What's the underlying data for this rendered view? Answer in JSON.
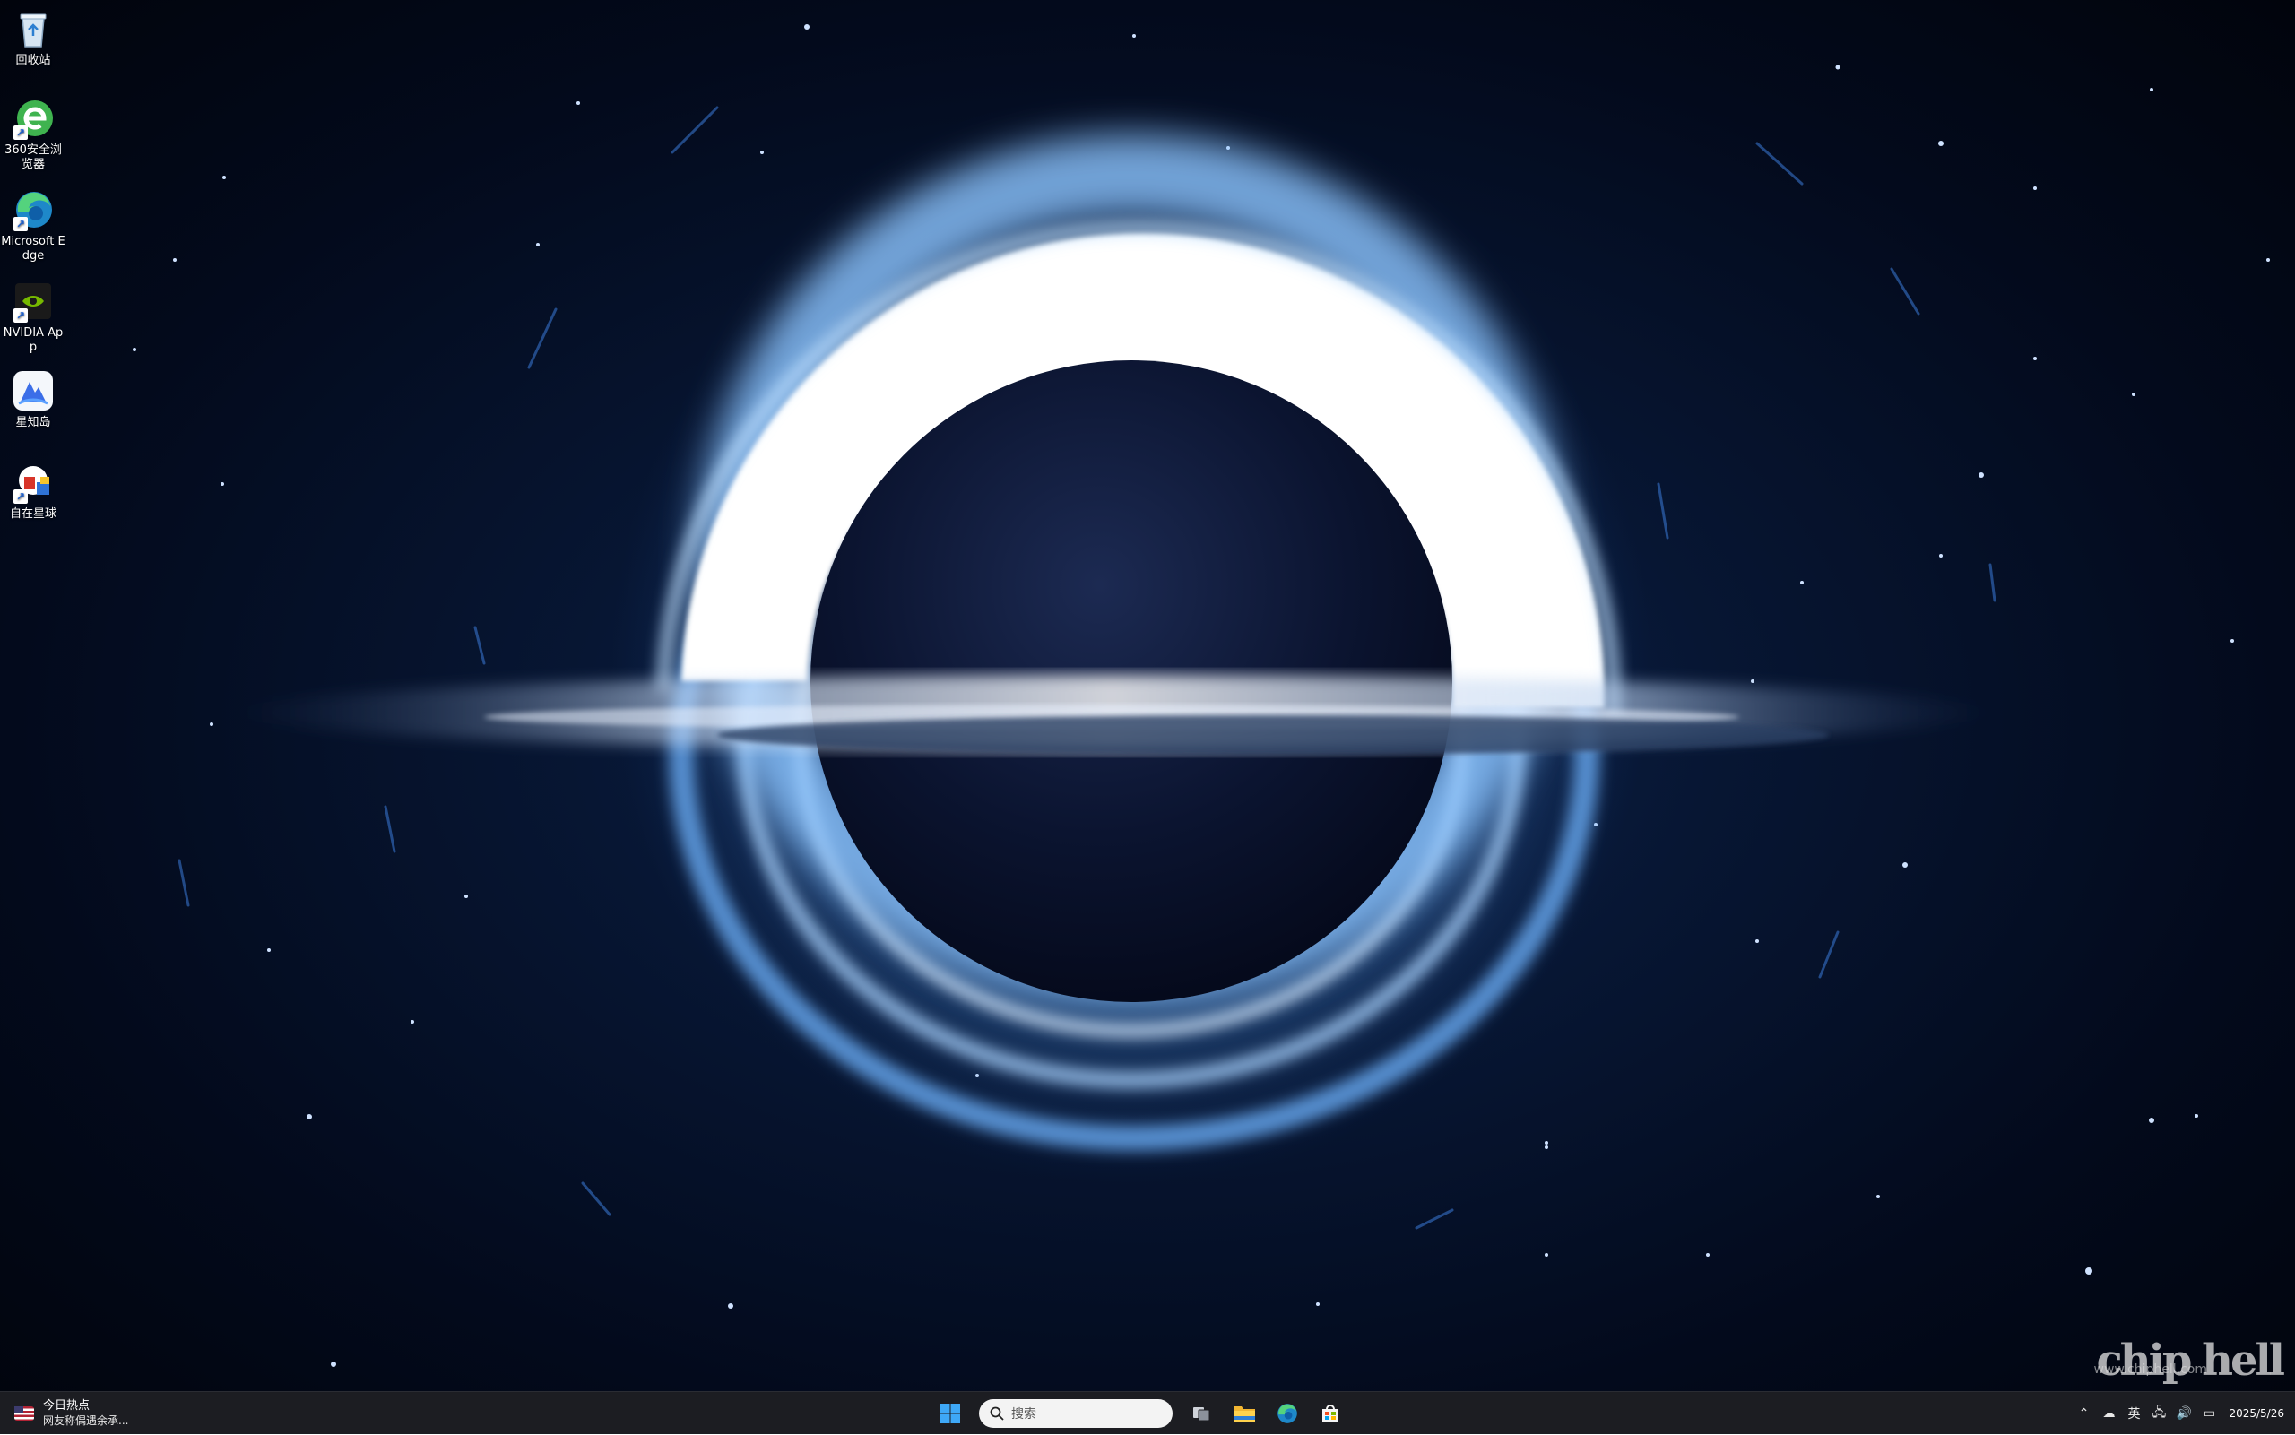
{
  "desktop": {
    "icons": [
      {
        "label": "回收站",
        "icon": "recycle-bin-icon"
      },
      {
        "label": "360安全浏览器",
        "icon": "360-browser-icon"
      },
      {
        "label": "Microsoft Edge",
        "icon": "edge-icon"
      },
      {
        "label": "NVIDIA App",
        "icon": "nvidia-icon"
      },
      {
        "label": "星知岛",
        "icon": "xingzhidao-icon"
      },
      {
        "label": "自在星球",
        "icon": "zizai-xingqiu-icon"
      }
    ],
    "watermark": {
      "logo": "chip hell",
      "url": "www.chiphell.com"
    }
  },
  "taskbar": {
    "widget": {
      "title": "今日热点",
      "subtitle": "网友称偶遇余承..."
    },
    "search": {
      "placeholder": "搜索"
    },
    "pinned": [
      "start-icon",
      "task-view-icon",
      "file-explorer-icon",
      "edge-icon",
      "store-icon"
    ],
    "tray": {
      "ime": "英",
      "time": "",
      "date": "2025/5/26"
    }
  }
}
